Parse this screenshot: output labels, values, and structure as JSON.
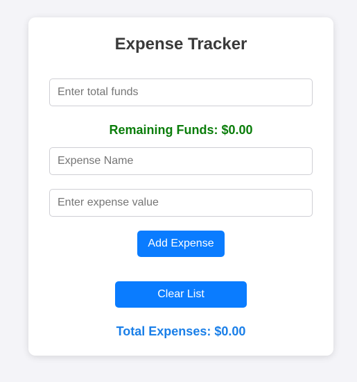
{
  "app": {
    "title": "Expense Tracker"
  },
  "funds_input": {
    "placeholder": "Enter total funds",
    "value": ""
  },
  "remaining": {
    "text": "Remaining Funds: $0.00"
  },
  "expense_name_input": {
    "placeholder": "Expense Name",
    "value": ""
  },
  "expense_value_input": {
    "placeholder": "Enter expense value",
    "value": ""
  },
  "buttons": {
    "add_label": "Add Expense",
    "clear_label": "Clear List"
  },
  "total": {
    "text": "Total Expenses: $0.00"
  },
  "colors": {
    "accent": "#0a7cff",
    "remaining_text": "#0a7d0a",
    "total_text": "#1a7fe8",
    "background": "#f4f4f8"
  }
}
